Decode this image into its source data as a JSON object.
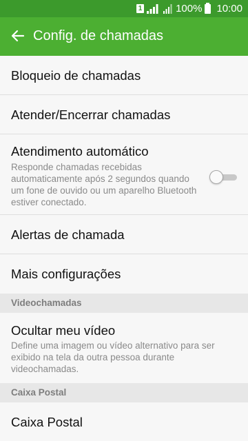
{
  "status_bar": {
    "sim_label": "1",
    "battery_percent": "100%",
    "time": "10:00"
  },
  "app_bar": {
    "title": "Config. de chamadas",
    "back_icon": "arrow-left-icon"
  },
  "items": {
    "call_blocking": {
      "title": "Bloqueio de chamadas"
    },
    "answer_end": {
      "title": "Atender/Encerrar chamadas"
    },
    "auto_answer": {
      "title": "Atendimento automático",
      "desc_lines": [
        "Responde chamadas recebidas",
        "automaticamente após 2 segundos quando",
        "um fone de ouvido ou um aparelho Bluetooth",
        "estiver conectado."
      ],
      "toggle_on": false
    },
    "call_alerts": {
      "title": "Alertas de chamada"
    },
    "more_settings": {
      "title": "Mais configurações"
    }
  },
  "sections": {
    "video": {
      "label": "Videochamadas",
      "hide_video": {
        "title": "Ocultar meu vídeo",
        "desc_lines": [
          "Define uma imagem ou vídeo alternativo para ser",
          "exibido na tela da outra pessoa durante",
          "videochamadas."
        ]
      }
    },
    "voicemail": {
      "label": "Caixa Postal",
      "item": {
        "title": "Caixa Postal"
      }
    }
  },
  "colors": {
    "status_bar": "#3c9a2c",
    "app_bar": "#4caf32",
    "background": "#f7f7f7",
    "section_bg": "#e7e7e7"
  }
}
